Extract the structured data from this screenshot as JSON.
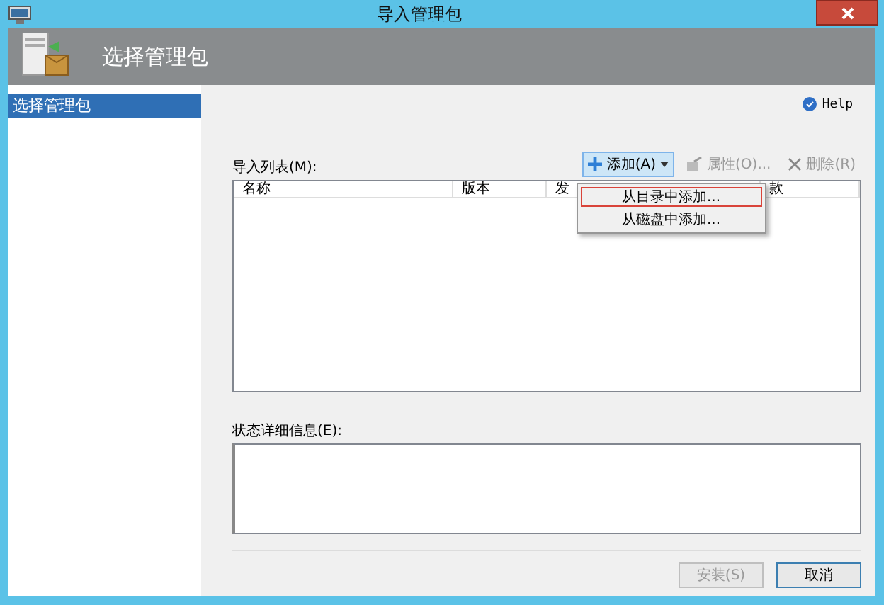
{
  "window": {
    "title": "导入管理包"
  },
  "header": {
    "title": "选择管理包"
  },
  "sidebar": {
    "items": [
      {
        "label": "选择管理包",
        "selected": true
      }
    ]
  },
  "help": {
    "label": "Help"
  },
  "import_list": {
    "label": "导入列表(M):",
    "columns": [
      "名称",
      "版本",
      "发",
      "款"
    ]
  },
  "toolbar": [
    {
      "kind": "add",
      "label": "添加(A)",
      "disabled": false
    },
    {
      "kind": "properties",
      "label": "属性(O)...",
      "disabled": true
    },
    {
      "kind": "delete",
      "label": "删除(R)",
      "disabled": true
    }
  ],
  "add_menu": {
    "items": [
      {
        "label": "从目录中添加...",
        "selected": true
      },
      {
        "label": "从磁盘中添加...",
        "selected": false
      }
    ]
  },
  "status_details": {
    "label": "状态详细信息(E):"
  },
  "buttons": [
    {
      "label": "安装(S)",
      "disabled": true
    },
    {
      "label": "取消",
      "disabled": false
    }
  ]
}
